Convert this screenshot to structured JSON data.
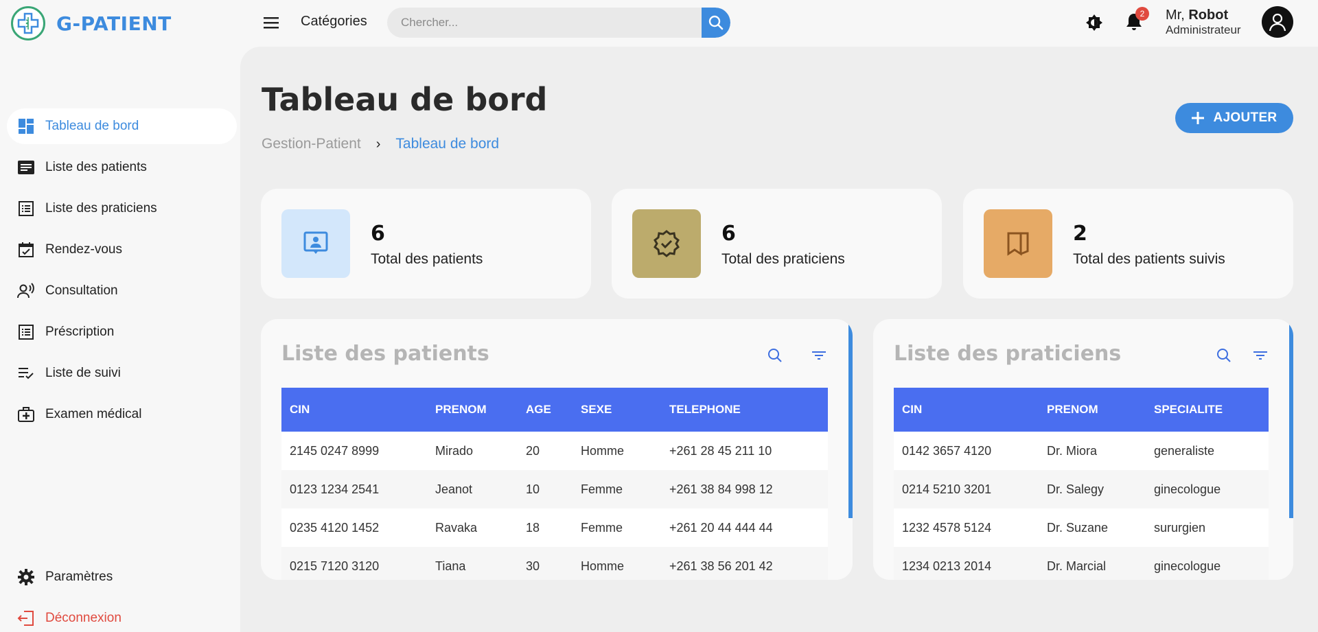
{
  "app": {
    "name": "G-PATIENT"
  },
  "header": {
    "categories_label": "Catégories",
    "search_placeholder": "Chercher...",
    "notification_count": "2",
    "user_prefix": "Mr,",
    "user_name": "Robot",
    "user_role": "Administrateur"
  },
  "sidebar": {
    "items": [
      {
        "label": "Tableau de bord",
        "icon": "dashboard-icon",
        "active": true
      },
      {
        "label": "Liste des patients",
        "icon": "list-card-icon"
      },
      {
        "label": "Liste des praticiens",
        "icon": "list-box-icon"
      },
      {
        "label": "Rendez-vous",
        "icon": "calendar-check-icon"
      },
      {
        "label": "Consultation",
        "icon": "person-voice-icon"
      },
      {
        "label": "Préscription",
        "icon": "list-box-icon"
      },
      {
        "label": "Liste de suivi",
        "icon": "checklist-icon"
      },
      {
        "label": "Examen médical",
        "icon": "medical-kit-icon"
      }
    ],
    "settings_label": "Paramètres",
    "logout_label": "Déconnexion"
  },
  "page": {
    "title": "Tableau de bord",
    "breadcrumb_root": "Gestion-Patient",
    "breadcrumb_current": "Tableau de bord",
    "add_button": "AJOUTER"
  },
  "stats": [
    {
      "value": "6",
      "label": "Total des patients",
      "color": "#d3e7fb"
    },
    {
      "value": "6",
      "label": "Total des praticiens",
      "color": "#bcab6c"
    },
    {
      "value": "2",
      "label": "Total des patients suivis",
      "color": "#e6aa66"
    }
  ],
  "patients_table": {
    "title": "Liste des patients",
    "columns": [
      "CIN",
      "PRENOM",
      "AGE",
      "SEXE",
      "TELEPHONE"
    ],
    "rows": [
      [
        "2145 0247 8999",
        "Mirado",
        "20",
        "Homme",
        "+261 28 45 211 10"
      ],
      [
        "0123 1234 2541",
        "Jeanot",
        "10",
        "Femme",
        "+261 38 84 998 12"
      ],
      [
        "0235 4120 1452",
        "Ravaka",
        "18",
        "Femme",
        "+261 20 44 444 44"
      ],
      [
        "0215 7120 3120",
        "Tiana",
        "30",
        "Homme",
        "+261 38 56 201 42"
      ]
    ]
  },
  "practitioners_table": {
    "title": "Liste des praticiens",
    "columns": [
      "CIN",
      "PRENOM",
      "SPECIALITE"
    ],
    "rows": [
      [
        "0142 3657 4120",
        "Dr. Miora",
        "generaliste"
      ],
      [
        "0214 5210 3201",
        "Dr. Salegy",
        "ginecologue"
      ],
      [
        "1232 4578 5124",
        "Dr. Suzane",
        "sururgien"
      ],
      [
        "1234 0213 2014",
        "Dr. Marcial",
        "ginecologue"
      ]
    ]
  },
  "colors": {
    "accent": "#3d8bde",
    "table_header": "#4a6ef0",
    "danger": "#e04a3f"
  }
}
